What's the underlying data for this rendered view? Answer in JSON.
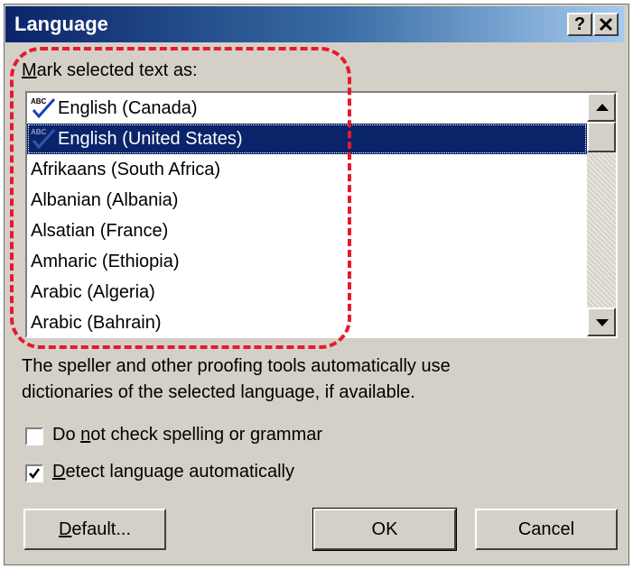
{
  "window": {
    "title": "Language",
    "help_button": "?",
    "close_button": "✕"
  },
  "mark_label": {
    "before": "",
    "mnemonic": "M",
    "after": "ark selected text as:"
  },
  "languages": [
    {
      "label": "English (Canada)",
      "spell_icon": true,
      "selected": false
    },
    {
      "label": "English (United States)",
      "spell_icon": true,
      "selected": true
    },
    {
      "label": "Afrikaans (South Africa)",
      "spell_icon": false,
      "selected": false
    },
    {
      "label": "Albanian (Albania)",
      "spell_icon": false,
      "selected": false
    },
    {
      "label": "Alsatian (France)",
      "spell_icon": false,
      "selected": false
    },
    {
      "label": "Amharic (Ethiopia)",
      "spell_icon": false,
      "selected": false
    },
    {
      "label": "Arabic (Algeria)",
      "spell_icon": false,
      "selected": false
    },
    {
      "label": "Arabic (Bahrain)",
      "spell_icon": false,
      "selected": false
    }
  ],
  "description": {
    "line1": "The speller and other proofing tools automatically use",
    "line2": "dictionaries of the selected language, if available."
  },
  "options": {
    "no_check": {
      "before": "Do ",
      "mnemonic": "n",
      "after": "ot check spelling or grammar",
      "checked": false
    },
    "detect": {
      "before": "",
      "mnemonic": "D",
      "after": "etect language automatically",
      "checked": true
    }
  },
  "buttons": {
    "default": {
      "before": "",
      "mnemonic": "D",
      "after": "efault..."
    },
    "ok": "OK",
    "cancel": "Cancel"
  },
  "colors": {
    "title_bar": "#0a246a",
    "selection": "#0a246a",
    "dialog_face": "#d4d0c8",
    "annotation": "#e8192c",
    "spell_check": "#1a3fbf"
  },
  "icons": {
    "spell": "abc-spellcheck-icon",
    "checkmark": "checkmark-icon",
    "scroll_up": "triangle-up-icon",
    "scroll_down": "triangle-down-icon"
  }
}
